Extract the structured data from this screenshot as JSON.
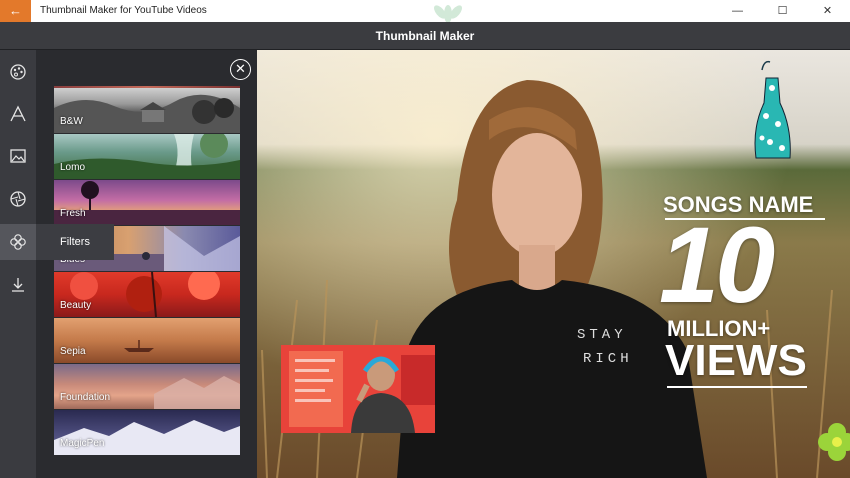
{
  "window": {
    "title": "Thumbnail Maker for YouTube Videos",
    "back_glyph": "←",
    "minimize_glyph": "—",
    "maximize_glyph": "☐",
    "close_glyph": "✕"
  },
  "app": {
    "title": "Thumbnail Maker"
  },
  "rail": {
    "items": [
      {
        "icon": "palette-icon"
      },
      {
        "icon": "text-icon",
        "glyph": "A"
      },
      {
        "icon": "image-icon"
      },
      {
        "icon": "aperture-icon"
      },
      {
        "icon": "filters-icon"
      },
      {
        "icon": "download-icon"
      }
    ],
    "tooltip": "Filters"
  },
  "panel": {
    "close_glyph": "✕",
    "filters": [
      {
        "label": "B&W"
      },
      {
        "label": "Lomo"
      },
      {
        "label": "Fresh"
      },
      {
        "label": "Blues"
      },
      {
        "label": "Beauty"
      },
      {
        "label": "Sepia"
      },
      {
        "label": "Foundation"
      },
      {
        "label": "MagicPen"
      }
    ]
  },
  "canvas": {
    "songs_name": "SONGS NAME",
    "number": "10",
    "million": "MILLION+",
    "views": "VIEWS",
    "shirt_text": "STAY RICH"
  },
  "colors": {
    "accent": "#e3792b",
    "panel_bg": "#2a2b2f",
    "rail_bg": "#3a3b40",
    "appbar_bg": "#3b3c40",
    "dress": "#29b7b3",
    "flower": "#9bd43a"
  }
}
